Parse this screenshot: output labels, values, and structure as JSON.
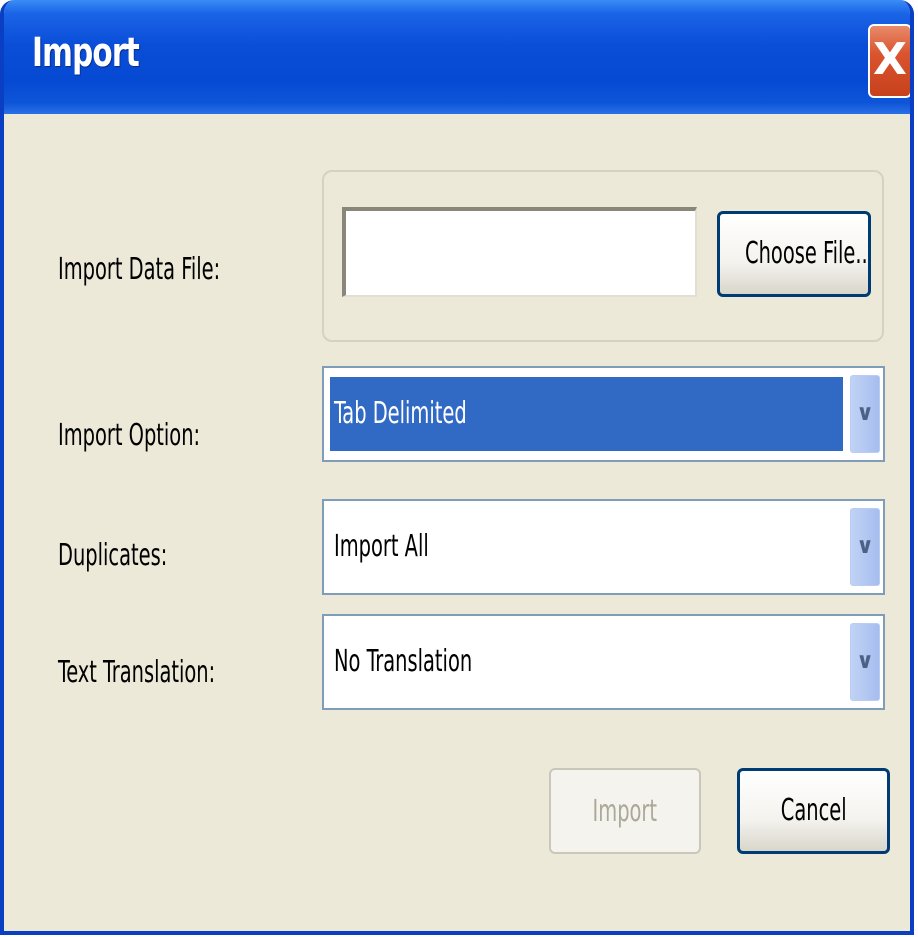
{
  "window": {
    "title": "Import",
    "close_glyph": "X"
  },
  "labels": {
    "data_file": "Import Data File:",
    "import_option": "Import Option:",
    "duplicates": "Duplicates:",
    "text_translation": "Text Translation:"
  },
  "file_input": {
    "value": ""
  },
  "buttons": {
    "choose_file": "Choose File...",
    "import": "Import",
    "cancel": "Cancel"
  },
  "selects": {
    "import_option": "Tab Delimited",
    "duplicates": "Import All",
    "text_translation": "No Translation"
  },
  "icons": {
    "close": "close-icon",
    "dropdown": "chevron-down-icon"
  },
  "colors": {
    "titlebar": "#0a4ed8",
    "selection": "#316ac5",
    "dialog_bg": "#ece9d8",
    "close": "#d9542f"
  }
}
